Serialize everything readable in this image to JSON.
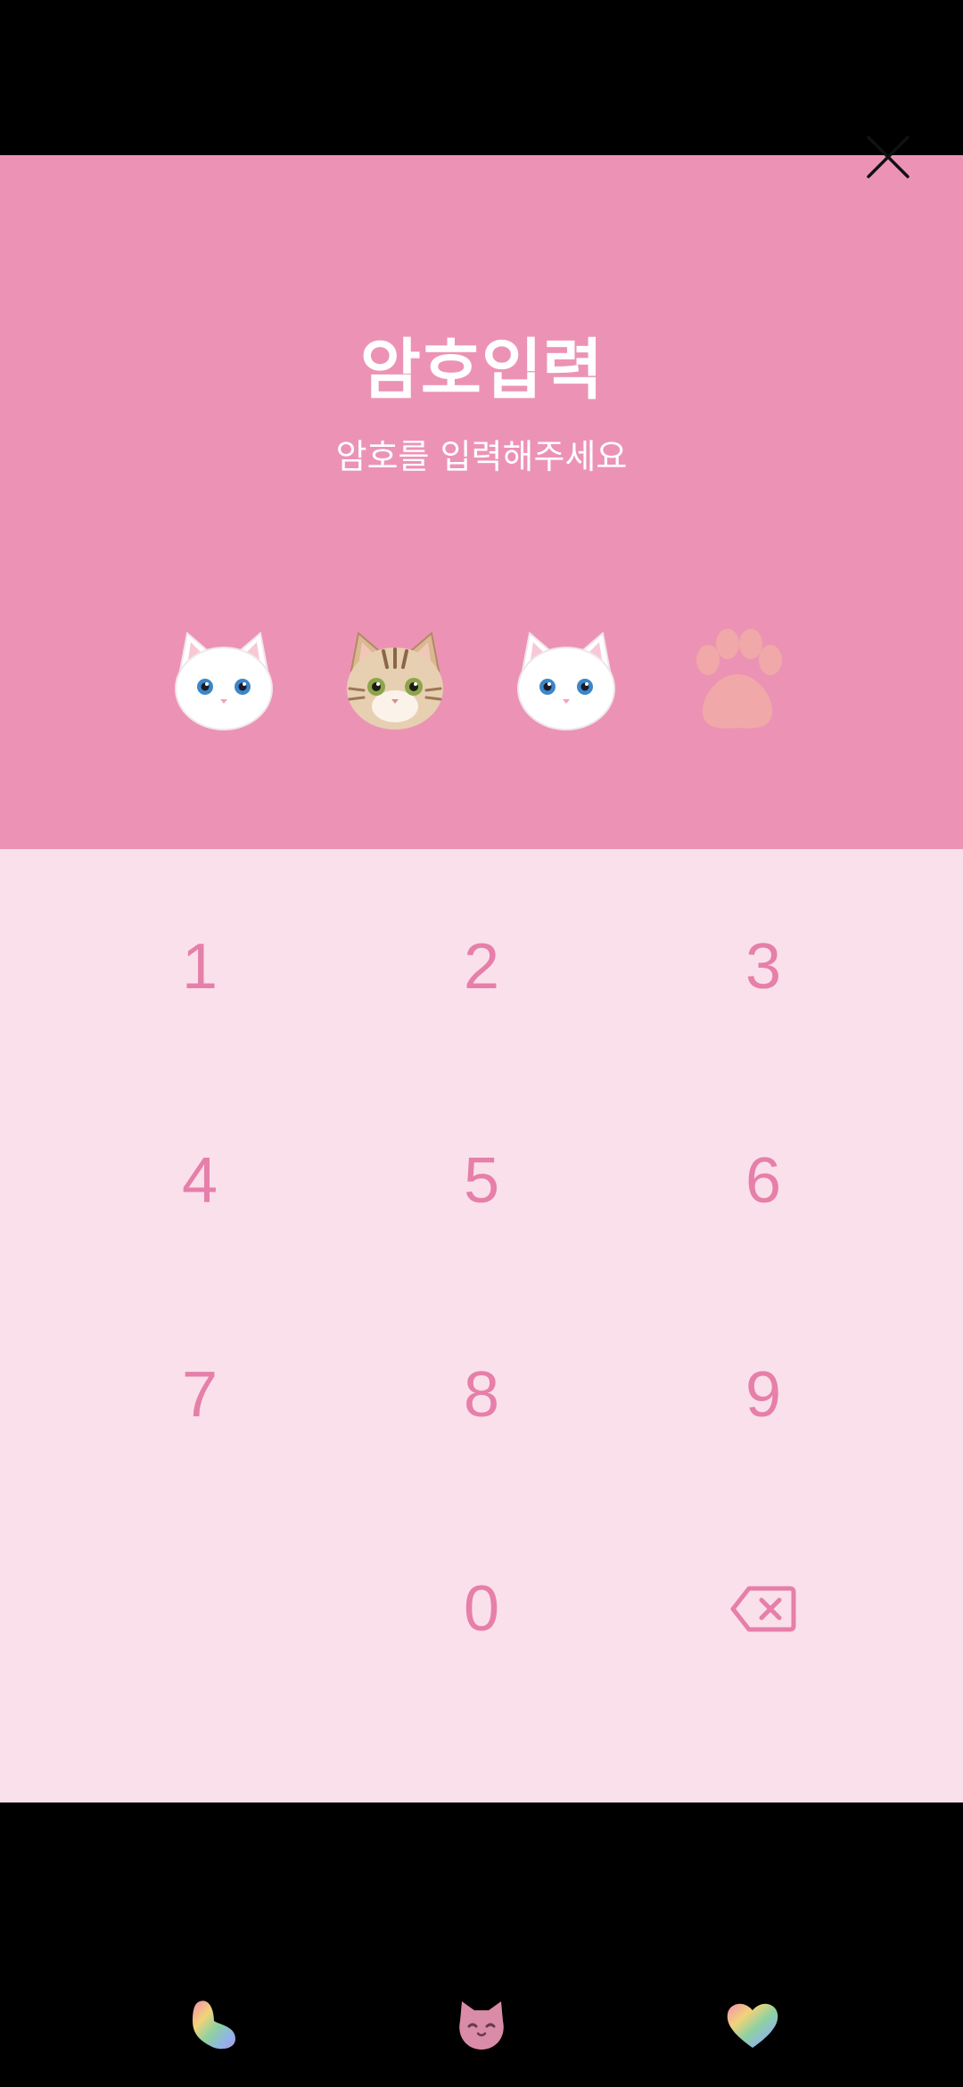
{
  "header": {
    "title": "암호입력",
    "subtitle": "암호를 입력해주세요"
  },
  "pin": {
    "length": 4,
    "entered": 3,
    "slots": [
      "white-cat-icon",
      "tabby-cat-icon",
      "white-cat-icon",
      "paw-print-icon"
    ]
  },
  "keypad": {
    "keys": [
      "1",
      "2",
      "3",
      "4",
      "5",
      "6",
      "7",
      "8",
      "9",
      "",
      "0",
      "backspace-icon"
    ]
  },
  "nav": {
    "icons": [
      "rainbow-bean-icon",
      "cat-face-icon",
      "rainbow-heart-icon"
    ]
  },
  "colors": {
    "header_bg": "#EC93B5",
    "keypad_bg": "#FAE0EB",
    "key_text": "#E67FA9",
    "paw_placeholder": "#F0A8A8"
  }
}
